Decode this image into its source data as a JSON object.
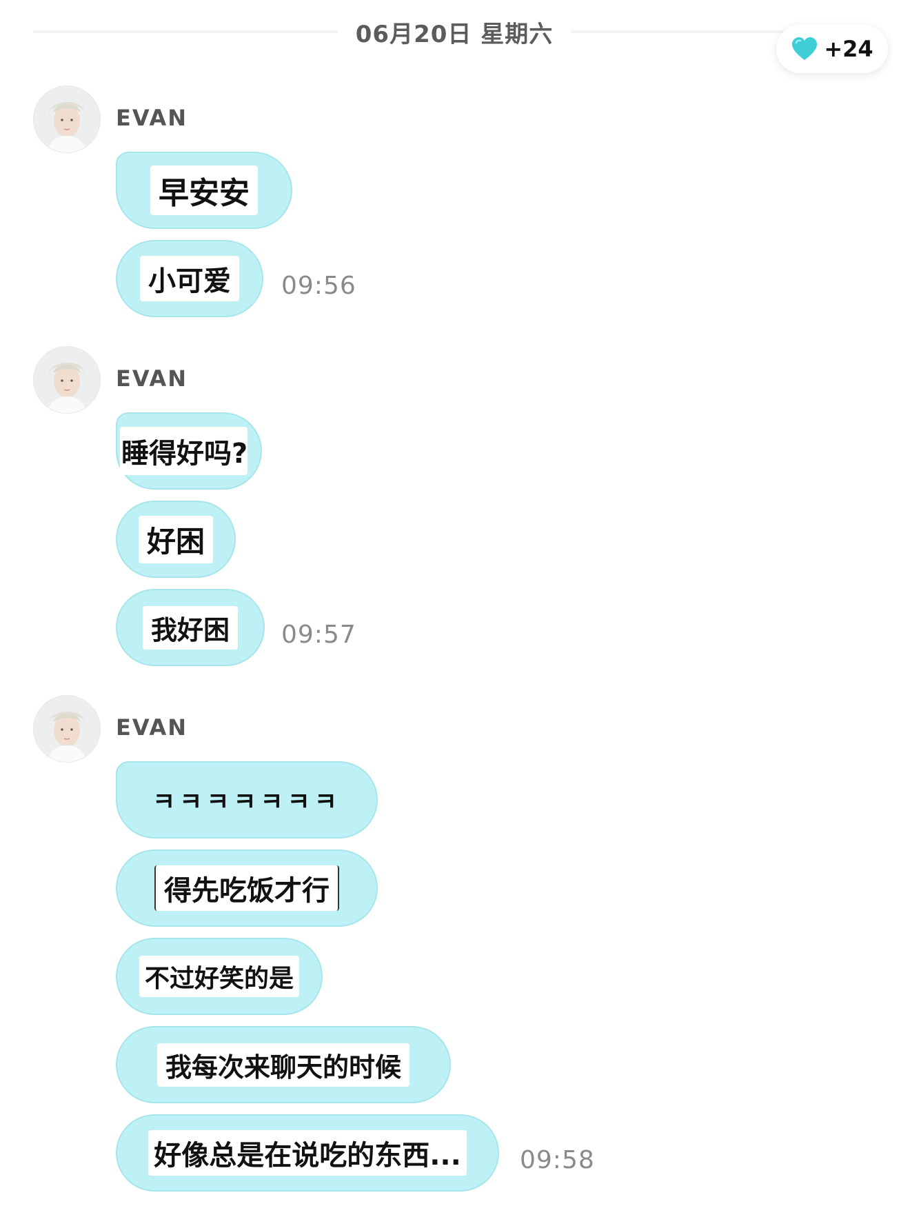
{
  "date_divider": "06月20日 星期六",
  "heart_badge": {
    "icon": "heart-icon",
    "count": "+24",
    "color": "#3ecfd6"
  },
  "colors": {
    "bubble": "#bdf1f5",
    "bubble_border": "#a8e5ea",
    "timestamp": "#8a8a8a"
  },
  "groups": [
    {
      "sender": "EVAN",
      "avatar": "avatar-photo",
      "messages": [
        "早安安",
        "小可爱"
      ],
      "time": "09:56"
    },
    {
      "sender": "EVAN",
      "avatar": "avatar-photo",
      "messages": [
        "睡得好吗?",
        "好困",
        "我好困"
      ],
      "time": "09:57"
    },
    {
      "sender": "EVAN",
      "avatar": "avatar-photo",
      "messages": [
        "ㅋㅋㅋㅋㅋㅋㅋ",
        "得先吃饭才行",
        "不过好笑的是",
        "我每次来聊天的时候",
        "好像总是在说吃的东西..."
      ],
      "time": "09:58"
    }
  ]
}
